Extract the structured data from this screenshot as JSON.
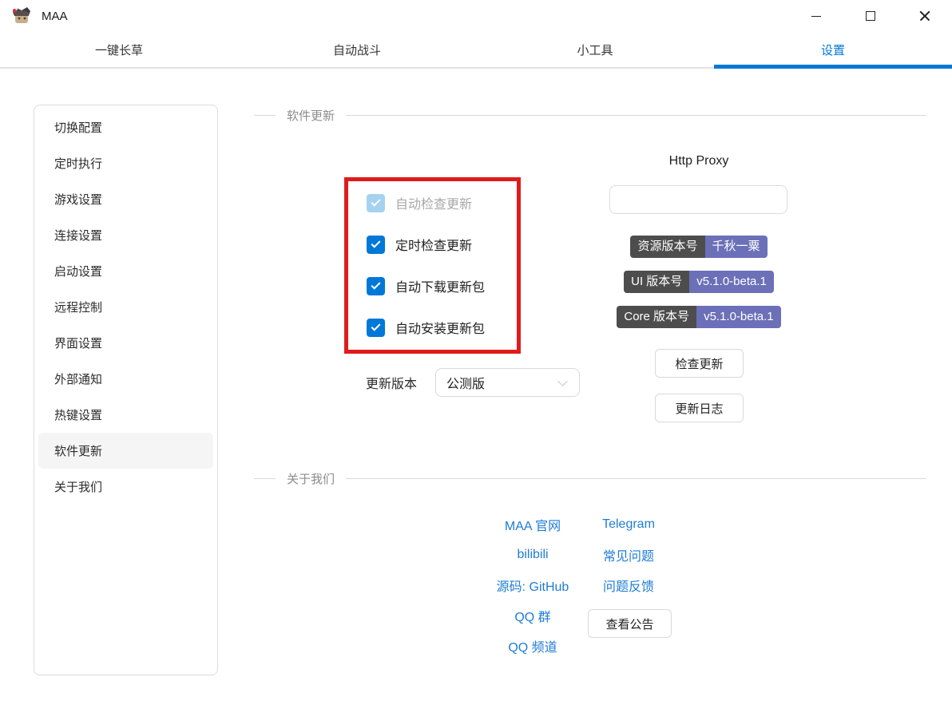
{
  "window": {
    "title": "MAA",
    "icon": "maa-avatar-icon"
  },
  "tabs": [
    {
      "label": "一键长草",
      "active": false
    },
    {
      "label": "自动战斗",
      "active": false
    },
    {
      "label": "小工具",
      "active": false
    },
    {
      "label": "设置",
      "active": true
    }
  ],
  "sidebar": {
    "items": [
      {
        "label": "切换配置",
        "selected": false
      },
      {
        "label": "定时执行",
        "selected": false
      },
      {
        "label": "游戏设置",
        "selected": false
      },
      {
        "label": "连接设置",
        "selected": false
      },
      {
        "label": "启动设置",
        "selected": false
      },
      {
        "label": "远程控制",
        "selected": false
      },
      {
        "label": "界面设置",
        "selected": false
      },
      {
        "label": "外部通知",
        "selected": false
      },
      {
        "label": "热键设置",
        "selected": false
      },
      {
        "label": "软件更新",
        "selected": true
      },
      {
        "label": "关于我们",
        "selected": false
      }
    ]
  },
  "update_section": {
    "title": "软件更新",
    "checkboxes": [
      {
        "label": "自动检查更新",
        "checked": true,
        "disabled": true
      },
      {
        "label": "定时检查更新",
        "checked": true,
        "disabled": false
      },
      {
        "label": "自动下载更新包",
        "checked": true,
        "disabled": false
      },
      {
        "label": "自动安装更新包",
        "checked": true,
        "disabled": false
      }
    ],
    "version_row": {
      "label": "更新版本",
      "selected_option": "公测版"
    },
    "http_proxy": {
      "title": "Http Proxy",
      "value": "",
      "placeholder": ""
    },
    "badges": [
      {
        "label": "资源版本号",
        "value": "千秋一粟"
      },
      {
        "label": "UI 版本号",
        "value": "v5.1.0-beta.1"
      },
      {
        "label": "Core 版本号",
        "value": "v5.1.0-beta.1"
      }
    ],
    "check_update_button": "检查更新",
    "changelog_button": "更新日志"
  },
  "about_section": {
    "title": "关于我们",
    "links_left": [
      "MAA 官网",
      "bilibili",
      "源码: GitHub",
      "QQ 群",
      "QQ 频道"
    ],
    "links_right": [
      "Telegram",
      "常见问题",
      "问题反馈"
    ],
    "announcement_button": "查看公告"
  },
  "annotation": {
    "type": "red-highlight-box",
    "color": "#e01b1c"
  },
  "colors": {
    "accent": "#0078d7",
    "link": "#1f7cd5",
    "badge_label_bg": "#4d4d4d",
    "badge_value_bg": "#6b70b8",
    "disabled_checkbox": "#a6d2f1",
    "sidebar_selected_bg": "#f5f5f5"
  }
}
